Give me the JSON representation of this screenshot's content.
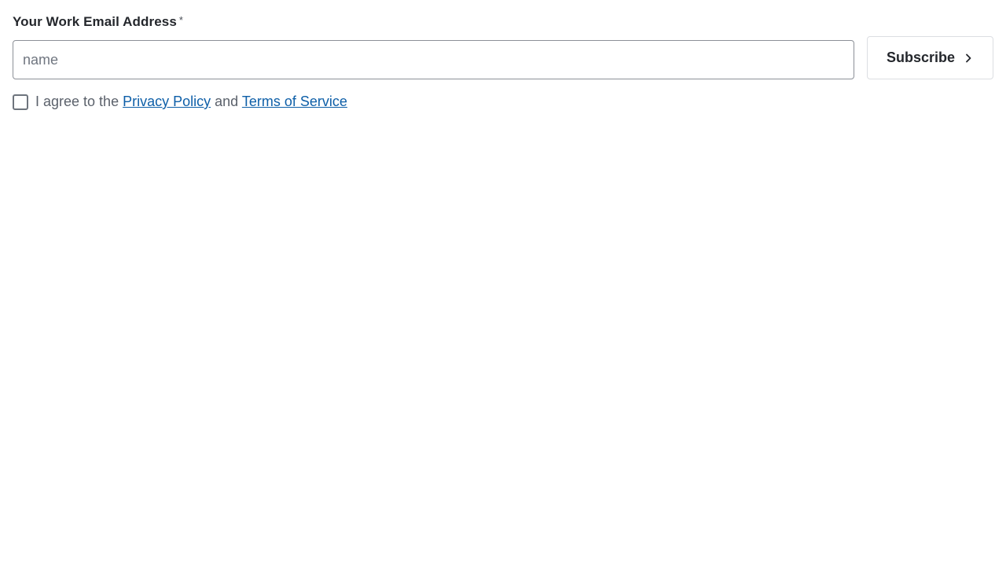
{
  "form": {
    "email_label": "Your Work Email Address",
    "required_mark": "*",
    "email_value": "",
    "email_placeholder": "name",
    "subscribe_label": "Subscribe",
    "subscribe_icon": "chevron-right-icon",
    "consent": {
      "checked": false,
      "prefix": "I agree to the",
      "privacy_link": "Privacy Policy",
      "conjunction": "and",
      "terms_link": "Terms of Service"
    }
  },
  "colors": {
    "text": "#24272c",
    "muted_text": "#5b616b",
    "link": "#0e5fa8",
    "input_border": "#8c9097",
    "button_border": "#dcdee2"
  }
}
